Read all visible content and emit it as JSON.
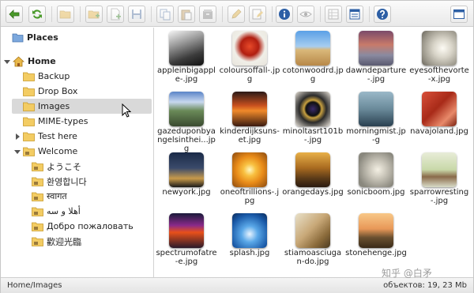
{
  "toolbar": {
    "buttons": [
      {
        "name": "back-button",
        "icon": "arrow-left-icon"
      },
      {
        "name": "reload-button",
        "icon": "refresh-icon"
      },
      {
        "name": "open-button",
        "icon": "folder-open-icon"
      },
      {
        "name": "new-folder-button",
        "icon": "folder-add-icon"
      },
      {
        "name": "new-file-button",
        "icon": "file-add-icon"
      },
      {
        "name": "save-button",
        "icon": "disk-icon"
      },
      {
        "name": "copy-button",
        "icon": "copy-icon"
      },
      {
        "name": "paste-button",
        "icon": "paste-icon"
      },
      {
        "name": "archive-button",
        "icon": "archive-icon"
      },
      {
        "name": "rename-button",
        "icon": "pencil-icon"
      },
      {
        "name": "edit-button",
        "icon": "edit-icon"
      },
      {
        "name": "info-button",
        "icon": "info-icon"
      },
      {
        "name": "preview-button",
        "icon": "eye-icon"
      },
      {
        "name": "icons-view-button",
        "icon": "grid-view-icon"
      },
      {
        "name": "list-view-button",
        "icon": "list-view-icon"
      },
      {
        "name": "help-button",
        "icon": "help-icon"
      },
      {
        "name": "fullscreen-button",
        "icon": "window-icon"
      }
    ]
  },
  "tree": {
    "places": "Places",
    "home": "Home",
    "items": [
      {
        "label": "Backup"
      },
      {
        "label": "Drop Box"
      },
      {
        "label": "Images"
      },
      {
        "label": "MIME-types"
      },
      {
        "label": "Test here"
      },
      {
        "label": "Welcome"
      },
      {
        "label": "ようこそ"
      },
      {
        "label": "환영합니다"
      },
      {
        "label": "स्वागत"
      },
      {
        "label": "أهلا و سه"
      },
      {
        "label": "Добро пожаловать"
      },
      {
        "label": "歡迎光臨"
      }
    ]
  },
  "files": [
    {
      "name": "appleinbigapple.jpg",
      "label": "appleinbigapple-.jpg"
    },
    {
      "name": "coloursoffall.jpg",
      "label": "coloursoffall-.jpg"
    },
    {
      "name": "cotonwoodrd.jpg",
      "label": "cotonwoodrd.jpg"
    },
    {
      "name": "dawndeparture.jpg",
      "label": "dawndeparture-.jpg"
    },
    {
      "name": "eyesofthevortex.jpg",
      "label": "eyesofthevorte-x.jpg"
    },
    {
      "name": "gazeduponbyangelsintheiturn.jpg",
      "label": "gazeduponbyangelsinthei...jpg"
    },
    {
      "name": "kinderdijksunset.jpg",
      "label": "kinderdijksuns-et.jpg"
    },
    {
      "name": "minoltasrt101b.jpg",
      "label": "minoltasrt101b-.jpg"
    },
    {
      "name": "morningmist.jpg",
      "label": "morningmist.jp-g"
    },
    {
      "name": "navajoland.jpg",
      "label": "navajoland.jpg"
    },
    {
      "name": "newyork.jpg",
      "label": "newyork.jpg"
    },
    {
      "name": "oneoftrillions.jpg",
      "label": "oneoftrillions-.jpg"
    },
    {
      "name": "orangedays.jpg",
      "label": "orangedays.jpg"
    },
    {
      "name": "sonicboom.jpg",
      "label": "sonicboom.jpg"
    },
    {
      "name": "sparrowresting.jpg",
      "label": "sparrowresting-.jpg"
    },
    {
      "name": "spectrumofatree.jpg",
      "label": "spectrumofatre-e.jpg"
    },
    {
      "name": "splash.jpg",
      "label": "splash.jpg"
    },
    {
      "name": "stiamoasciugando.jpg",
      "label": "stiamoasciugan-do.jpg"
    },
    {
      "name": "stonehenge.jpg",
      "label": "stonehenge.jpg"
    }
  ],
  "status": {
    "path": "Home/Images",
    "info": "объектов: 19, 23 Mb"
  },
  "watermark": "知乎 @白矛"
}
